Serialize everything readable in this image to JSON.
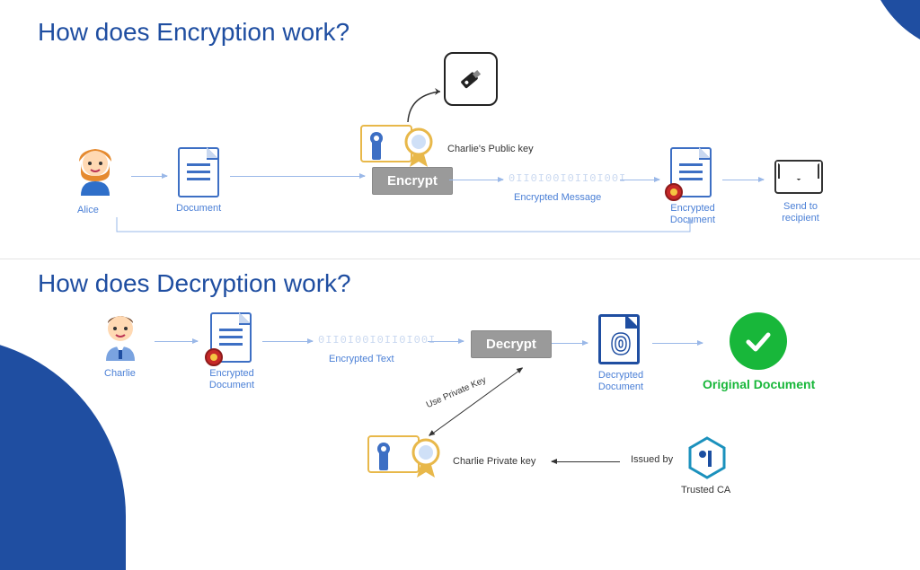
{
  "titles": {
    "encryption": "How does Encryption work?",
    "decryption": "How does Decryption work?"
  },
  "encryption": {
    "alice": "Alice",
    "document": "Document",
    "charlie_public_key": "Charlie's Public key",
    "encrypt_action": "Encrypt",
    "encrypted_message": "Encrypted Message",
    "binary": "0II0I00I0II0I00I",
    "encrypted_document": "Encrypted Document",
    "send_to_recipient": "Send to\nrecipient"
  },
  "decryption": {
    "charlie": "Charlie",
    "encrypted_document": "Encrypted\nDocument",
    "encrypted_text": "Encrypted Text",
    "binary": "0II0I00I0II0I00I",
    "decrypt_action": "Decrypt",
    "use_private_key": "Use Private Key",
    "charlie_private_key": "Charlie Private key",
    "issued_by": "Issued by",
    "trusted_ca": "Trusted CA",
    "decrypted_document": "Decrypted\nDocument",
    "original_document": "Original Document"
  }
}
